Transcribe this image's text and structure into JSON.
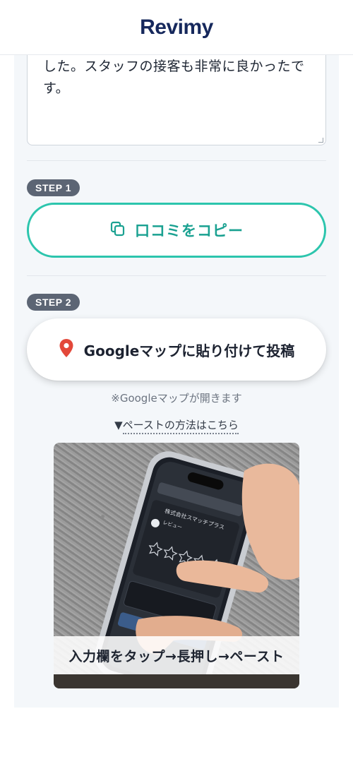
{
  "header": {
    "logo": "Revimy"
  },
  "review": {
    "text": "思いました。友人と楽しい時間を過ごせました。スタッフの接客も非常に良かったです。"
  },
  "step1": {
    "badge": "STEP 1",
    "copy_button_label": "口コミをコピー"
  },
  "step2": {
    "badge": "STEP 2",
    "maps_button_label": "Googleマップに貼り付けて投稿",
    "note": "※Googleマップが開きます",
    "howto_arrow": "▼",
    "howto_link": "ペーストの方法はこちら"
  },
  "howto_image": {
    "caption": "入力欄をタップ→長押し→ペースト",
    "screen_title": "株式会社スマッチプラス",
    "reviewer_label": "レビュー",
    "rating_total": 5
  },
  "colors": {
    "logo": "#16285c",
    "accent_teal": "#2cc5ad",
    "badge_bg": "#5c6574",
    "map_pin": "#e3483a"
  },
  "icons": {
    "copy": "copy-icon",
    "map_pin": "map-pin-icon"
  }
}
